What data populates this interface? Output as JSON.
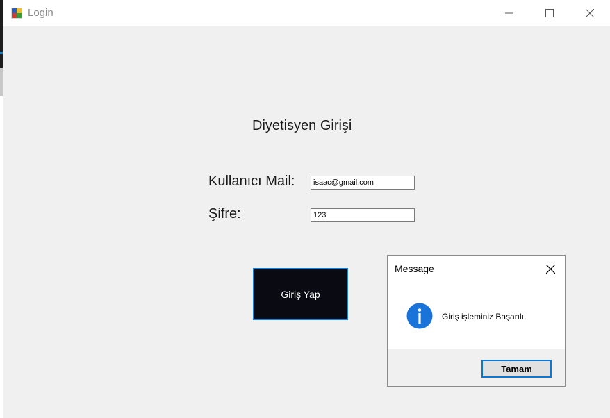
{
  "window": {
    "title": "Login",
    "icon": "app-window-icon"
  },
  "controls": {
    "minimize": "minimize-icon",
    "maximize": "maximize-icon",
    "close": "close-icon"
  },
  "form": {
    "heading": "Diyetisyen Girişi",
    "mail_label": "Kullanıcı Mail:",
    "mail_value": "isaac@gmail.com",
    "password_label": "Şifre:",
    "password_value": "123",
    "login_button": "Giriş Yap"
  },
  "message_box": {
    "title": "Message",
    "icon": "info-icon",
    "text": "Giriş işleminiz Başarılı.",
    "ok_button": "Tamam"
  },
  "colors": {
    "accent": "#0a78d7",
    "button_dark": "#0a0a12",
    "info_blue": "#1a73d9"
  }
}
